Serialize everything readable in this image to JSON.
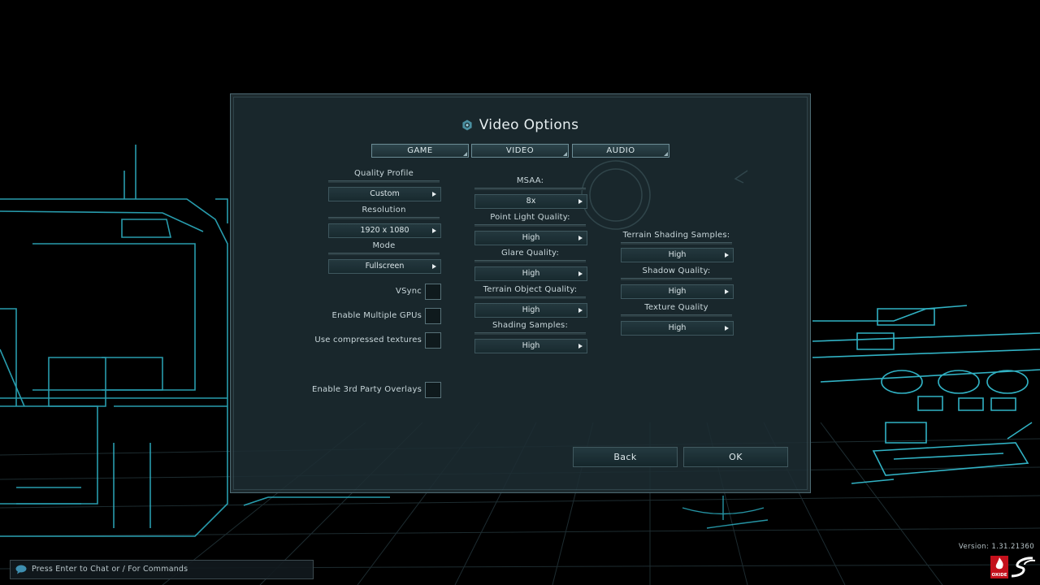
{
  "dialog": {
    "title": "Video Options",
    "tabs": [
      {
        "label": "GAME"
      },
      {
        "label": "VIDEO"
      },
      {
        "label": "AUDIO"
      }
    ]
  },
  "left_column": {
    "quality_profile": {
      "label": "Quality Profile",
      "value": "Custom"
    },
    "resolution": {
      "label": "Resolution",
      "value": "1920 x 1080"
    },
    "mode": {
      "label": "Mode",
      "value": "Fullscreen"
    },
    "checkboxes": {
      "vsync": {
        "label": "VSync",
        "checked": false
      },
      "multi_gpu": {
        "label": "Enable Multiple GPUs",
        "checked": false
      },
      "compressed_textures": {
        "label": "Use compressed textures",
        "checked": false
      },
      "third_party_overlays": {
        "label": "Enable 3rd Party Overlays",
        "checked": false
      }
    }
  },
  "middle_column": {
    "msaa": {
      "label": "MSAA:",
      "value": "8x"
    },
    "point_light_quality": {
      "label": "Point Light Quality:",
      "value": "High"
    },
    "glare_quality": {
      "label": "Glare Quality:",
      "value": "High"
    },
    "terrain_object_quality": {
      "label": "Terrain Object Quality:",
      "value": "High"
    },
    "shading_samples": {
      "label": "Shading Samples:",
      "value": "High"
    }
  },
  "right_column": {
    "terrain_shading_samples": {
      "label": "Terrain Shading Samples:",
      "value": "High"
    },
    "shadow_quality": {
      "label": "Shadow Quality:",
      "value": "High"
    },
    "texture_quality": {
      "label": "Texture Quality",
      "value": "High"
    }
  },
  "buttons": {
    "back": "Back",
    "ok": "OK"
  },
  "footer": {
    "version": "Version: 1.31.21360",
    "chat_prompt": "Press Enter to Chat or / For Commands",
    "logo_oxide_text": "OXIDE"
  },
  "colors": {
    "accent_cyan": "#3fd2e6",
    "panel_bg": "#1c2c32",
    "logo_red": "#c4101c"
  },
  "icons": {
    "title": "options-gear-icon",
    "select_arrow": "triangle-right-icon",
    "chat": "chat-bubble-icon"
  }
}
